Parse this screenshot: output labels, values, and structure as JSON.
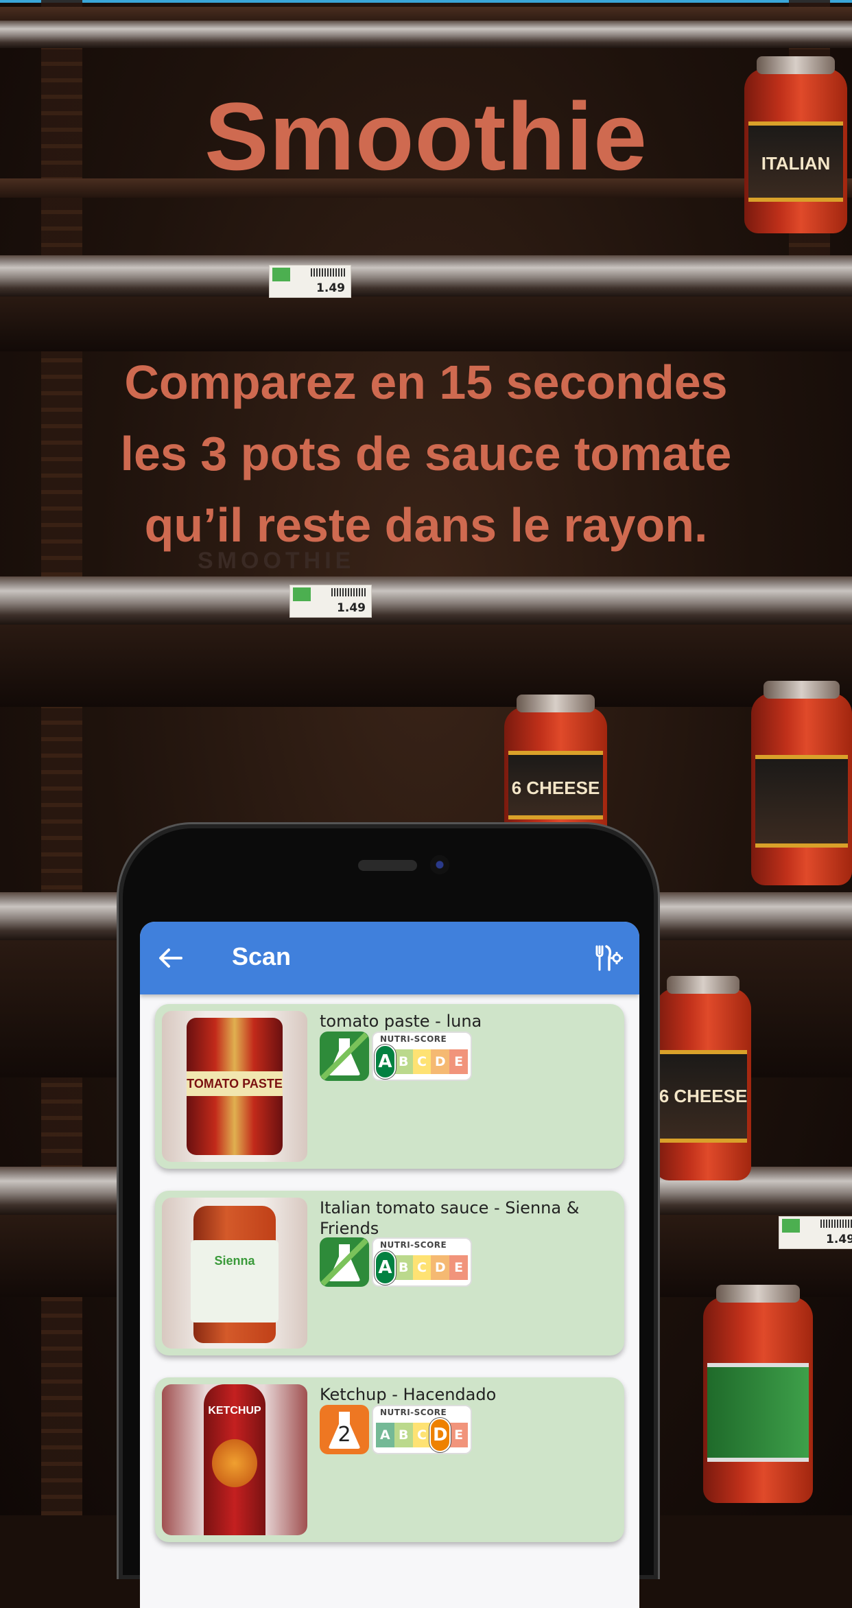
{
  "promo": {
    "title": "Smoothie",
    "subtitle_lines": [
      "Comparez en 15 secondes",
      "les 3 pots de sauce tomate",
      "qu’il reste dans le rayon."
    ],
    "watermark": "SMOOTHIE"
  },
  "background": {
    "price_tags": [
      "1.49",
      "1.49",
      "1.49"
    ],
    "jar_labels": [
      "6 CHEESE",
      "6 CHEESE",
      "ITALIAN"
    ]
  },
  "app": {
    "appbar": {
      "title": "Scan",
      "back_icon": "arrow-back-icon",
      "prefs_icon": "food-preferences-icon",
      "color": "#4080dc"
    },
    "products": [
      {
        "title": "tomato paste - luna",
        "nova_group": "",
        "nova_color": "#2e8b3a",
        "nutri_header": "NUTRI-SCORE",
        "nutri_grade": "A",
        "thumb_label": "TOMATO PASTE"
      },
      {
        "title": "Italian tomato sauce - Sienna & Friends",
        "nova_group": "",
        "nova_color": "#2e8b3a",
        "nutri_header": "NUTRI-SCORE",
        "nutri_grade": "A",
        "thumb_label": "Sienna"
      },
      {
        "title": "Ketchup - Hacendado",
        "nova_group": "2",
        "nova_color": "#ee7722",
        "nutri_header": "NUTRI-SCORE",
        "nutri_grade": "D",
        "thumb_label": "KETCHUP"
      }
    ]
  }
}
